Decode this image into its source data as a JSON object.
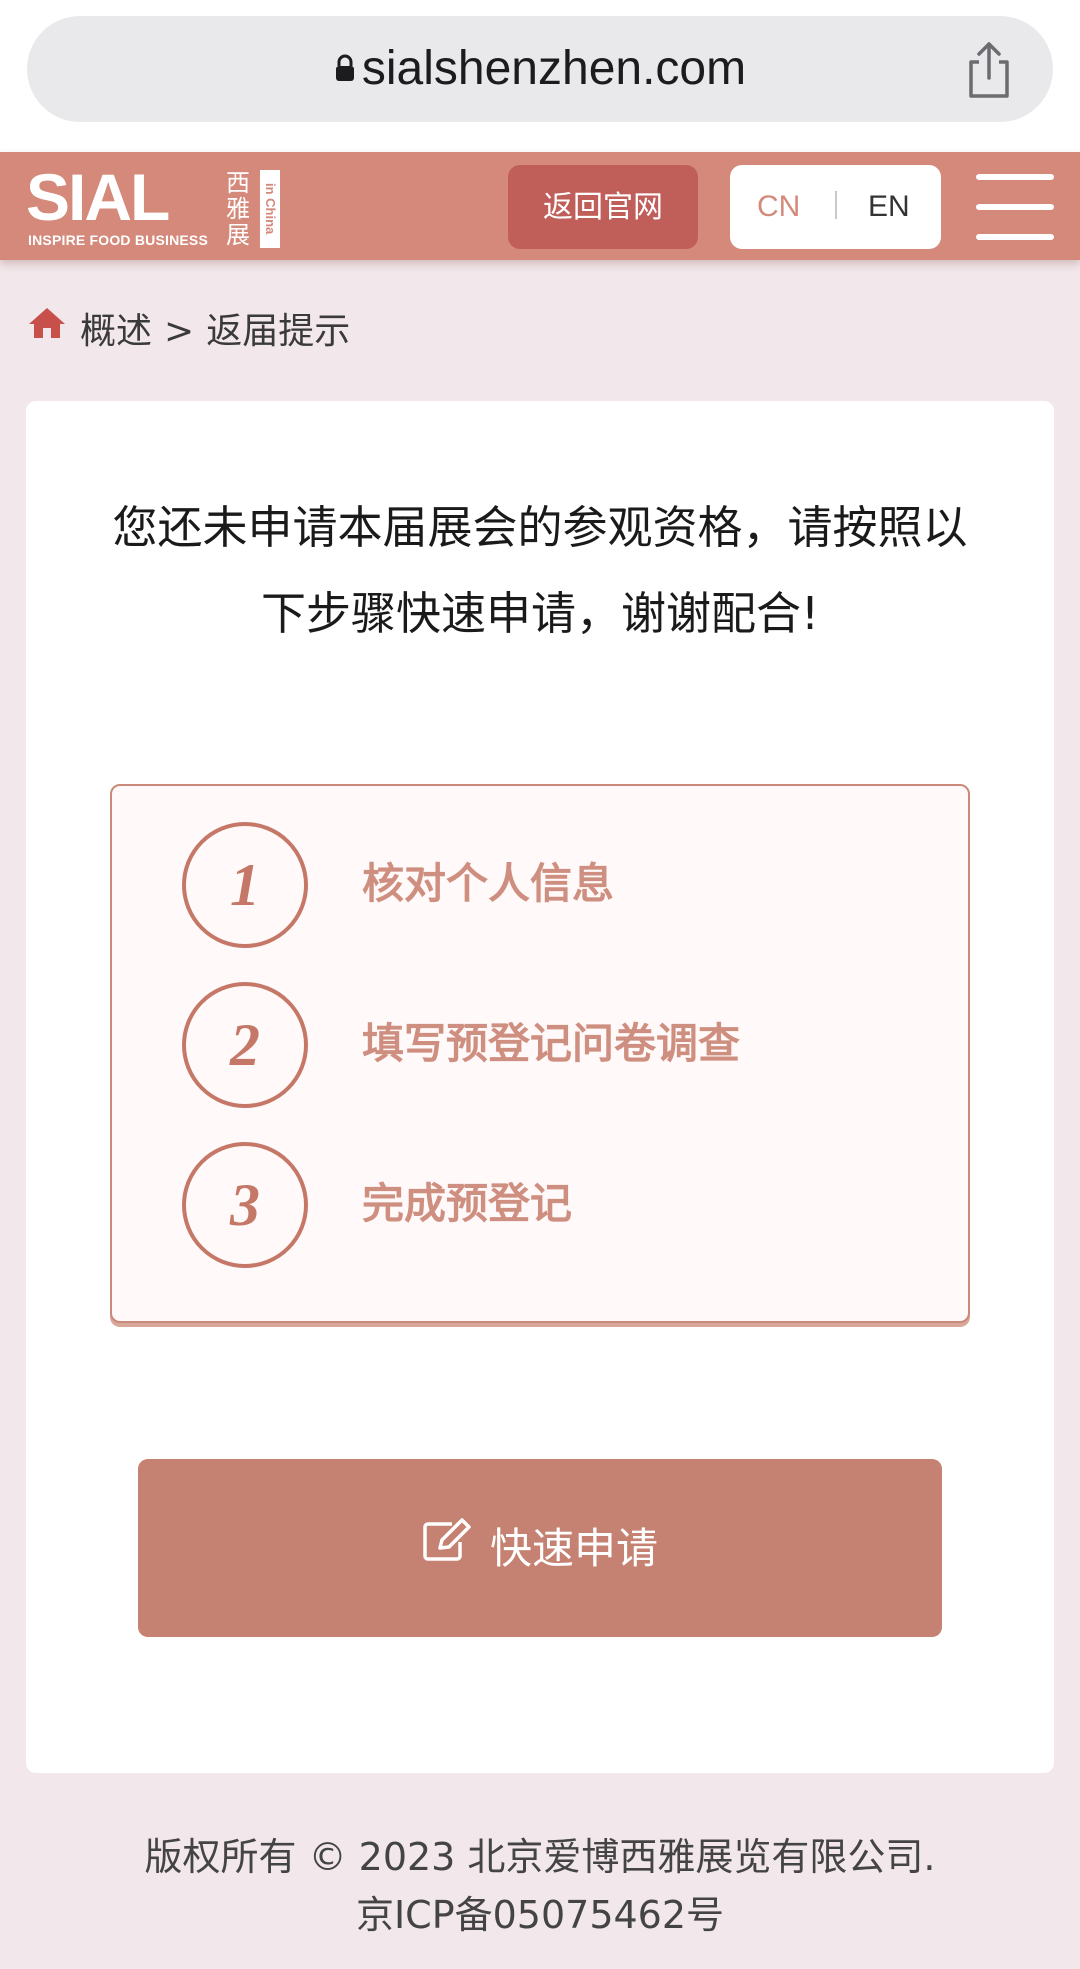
{
  "browser": {
    "url": "sialshenzhen.com"
  },
  "header": {
    "logo_text": "SIAL",
    "logo_tagline": "INSPIRE FOOD BUSINESS",
    "logo_cn": "西雅展",
    "logo_tag": "in China",
    "back_button_label": "返回官网",
    "lang_cn": "CN",
    "lang_en": "EN"
  },
  "breadcrumb": {
    "item_1": "概述",
    "separator": ">",
    "item_2": "返届提示"
  },
  "main": {
    "notice": "您还未申请本届展会的参观资格，请按照以下步骤快速申请，谢谢配合!",
    "steps": [
      {
        "number": "1",
        "label": "核对个人信息"
      },
      {
        "number": "2",
        "label": "填写预登记问卷调查"
      },
      {
        "number": "3",
        "label": "完成预登记"
      }
    ],
    "apply_button_label": "快速申请"
  },
  "footer": {
    "copyright": "版权所有 © 2023 北京爱博西雅展览有限公司.",
    "icp": "京ICP备05075462号"
  },
  "colors": {
    "brand": "#d4897a",
    "back_button": "#c05f5a",
    "apply_button": "#c58272",
    "page_background": "#f2e7ea"
  },
  "icons": {
    "lock": "lock-icon",
    "share": "share-icon",
    "menu": "hamburger-menu-icon",
    "home": "home-icon",
    "edit": "edit-icon"
  }
}
